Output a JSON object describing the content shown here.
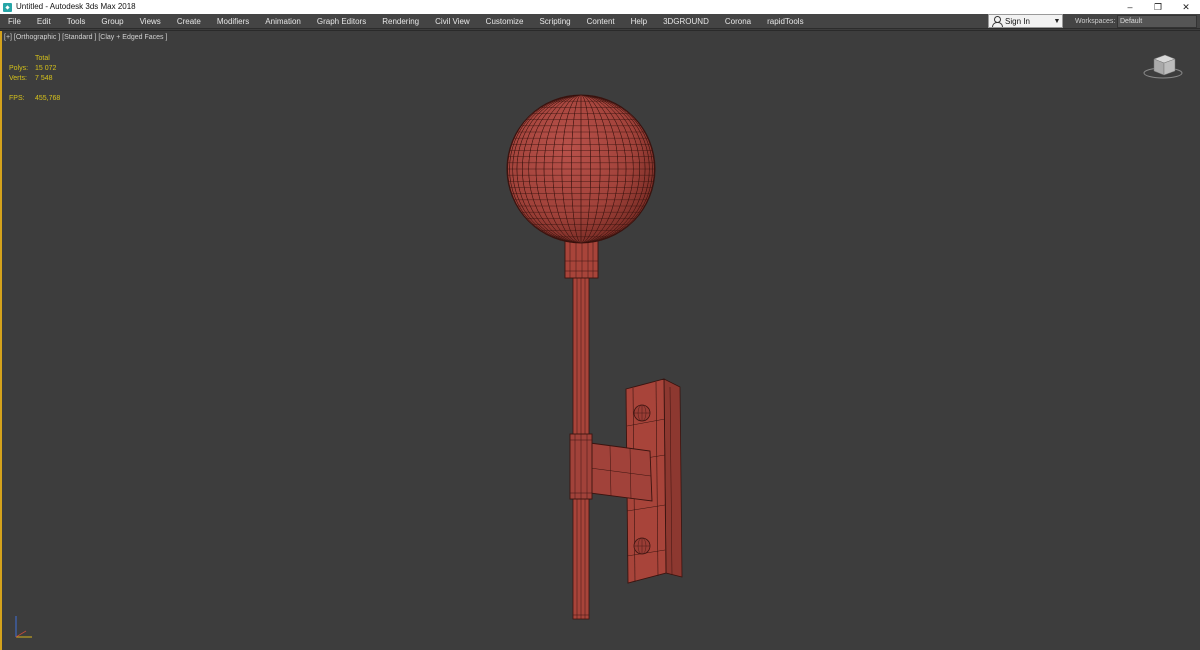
{
  "window": {
    "title": "Untitled - Autodesk 3ds Max 2018",
    "controls": {
      "minimize": "–",
      "restore": "❐",
      "close": "✕"
    }
  },
  "menubar": {
    "items": [
      "File",
      "Edit",
      "Tools",
      "Group",
      "Views",
      "Create",
      "Modifiers",
      "Animation",
      "Graph Editors",
      "Rendering",
      "Civil View",
      "Customize",
      "Scripting",
      "Content",
      "Help",
      "3DGROUND",
      "Corona",
      "rapidTools"
    ],
    "signin_label": "Sign In",
    "workspaces_label": "Workspaces:",
    "workspace_value": "Default"
  },
  "viewport": {
    "label": "[+] [Orthographic ] [Standard ] [Clay + Edged Faces ]",
    "stats": {
      "header": "Total",
      "polys_label": "Polys:",
      "polys_value": "15 072",
      "verts_label": "Verts:",
      "verts_value": "7 548",
      "fps_label": "FPS:",
      "fps_value": "455,768"
    }
  },
  "colors": {
    "viewport_bg": "#3d3d3d",
    "clay": "#a8443a",
    "wire": "#3a1410",
    "stats_text": "#d6c21b",
    "viewport_border": "#d4a21c"
  },
  "icons": {
    "app": "3dsmax-logo-icon",
    "signin": "user-icon",
    "dropdown": "chevron-down-icon",
    "viewcube": "viewcube-icon",
    "axis": "axis-tripod-icon"
  }
}
